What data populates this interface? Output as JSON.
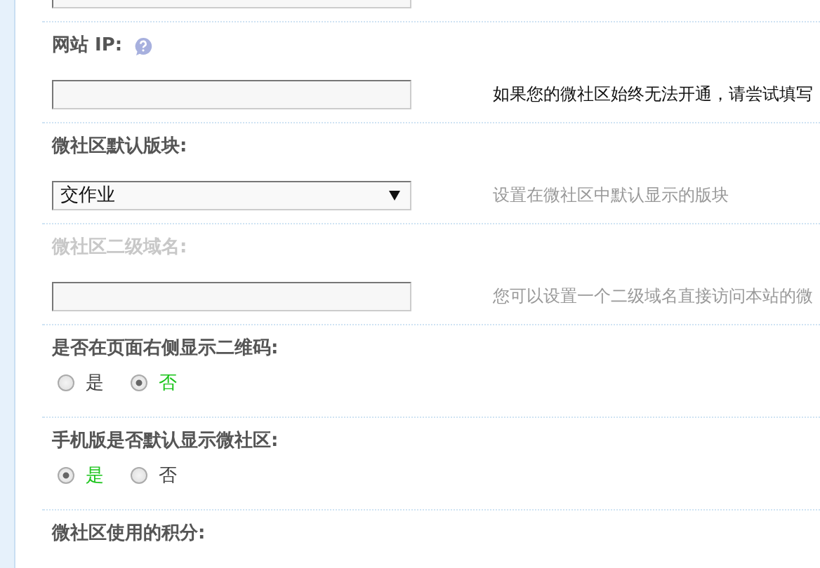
{
  "settings": [
    {
      "kind": "text"
    },
    {
      "kind": "text",
      "label": "网站 IP:",
      "help": true,
      "disabled": false,
      "hint": "如果您的微社区始终无法开通，请尝试填写",
      "hint_emphasis": true
    },
    {
      "kind": "select",
      "label": "微社区默认版块:",
      "disabled": false,
      "value": "交作业",
      "hint": "设置在微社区中默认显示的版块",
      "hint_emphasis": false
    },
    {
      "kind": "text",
      "label": "微社区二级域名:",
      "disabled": true,
      "hint": "您可以设置一个二级域名直接访问本站的微",
      "hint_emphasis": false
    },
    {
      "kind": "radio",
      "label": "是否在页面右侧显示二维码:",
      "disabled": false,
      "options": [
        {
          "label": "是",
          "selected": false
        },
        {
          "label": "否",
          "selected": true
        }
      ]
    },
    {
      "kind": "radio",
      "label": "手机版是否默认显示微社区:",
      "disabled": false,
      "options": [
        {
          "label": "是",
          "selected": true
        },
        {
          "label": "否",
          "selected": false
        }
      ]
    },
    {
      "kind": "heading",
      "label": "微社区使用的积分:",
      "disabled": false
    }
  ]
}
